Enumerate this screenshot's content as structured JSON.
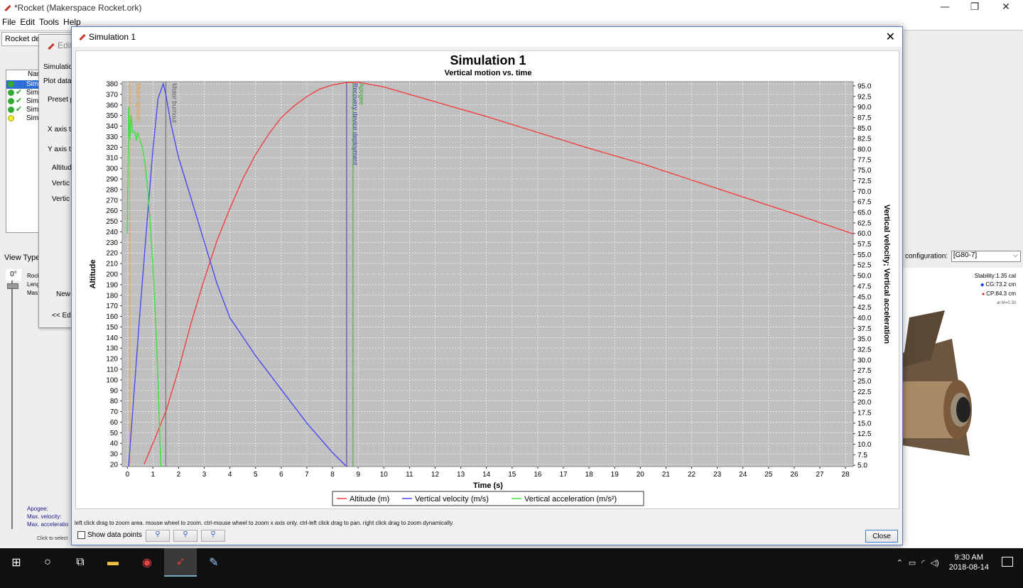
{
  "app": {
    "title": "*Rocket (Makerspace Rocket.ork)",
    "menu": [
      "File",
      "Edit",
      "Tools",
      "Help"
    ],
    "rocket_design_tab": "Rocket desi",
    "simulations": [
      {
        "label": "Simu",
        "status": "selected"
      },
      {
        "label": "Simu",
        "status": "ok"
      },
      {
        "label": "Simu",
        "status": "ok"
      },
      {
        "label": "Simu",
        "status": "ok"
      },
      {
        "label": "Simu",
        "status": "outdated"
      }
    ],
    "sim_list_header": "Nan",
    "view_type": "View Type:",
    "angle": "0°",
    "rocket_info": [
      "Rock",
      "Leng",
      "Mas"
    ],
    "flight_info": [
      "Apogee:",
      "Max. velocity:",
      "Max. acceleratio"
    ],
    "click_select": "Click to select",
    "configuration_label": "configuration:",
    "configuration_value": "[G80-7]",
    "stability": "Stability:1.35 cal",
    "cg": "CG:73.2 cm",
    "cp": "CP:84.3 cm",
    "mach": "at M=0.30"
  },
  "edit_dialog": {
    "title": "Edit",
    "simulation_tab": "Simulatio",
    "plot_tab": "Plot data",
    "preset": "Preset p",
    "x_axis": "X axis t",
    "y_axis": "Y axis t",
    "y_items": [
      "Altitud",
      "Vertic",
      "Vertic"
    ],
    "new_button": "New",
    "edit_button": "<< Ed"
  },
  "plot_dialog": {
    "title": "Simulation 1",
    "hint": "left click drag to zoom area. mouse wheel to zoom. ctrl-mouse wheel to zoom x axis only. ctrl-left click drag to pan.  right click drag to zoom dynamically.",
    "show_data_points": "Show data points",
    "close": "Close",
    "zoom_buttons": [
      "zoom-in",
      "zoom-out",
      "zoom-fit"
    ]
  },
  "chart_data": {
    "type": "line",
    "title": "Simulation 1",
    "subtitle": "Vertical motion vs. time",
    "xlabel": "Time (s)",
    "ylabel": "Altitude",
    "y2label": "Vertical velocity; Vertical acceleration",
    "xlim": [
      -0.2,
      28.3
    ],
    "ylim": [
      18,
      382
    ],
    "y2lim": [
      4.7,
      96.0
    ],
    "x_ticks": [
      0,
      1,
      2,
      3,
      4,
      5,
      6,
      7,
      8,
      9,
      10,
      11,
      12,
      13,
      14,
      15,
      16,
      17,
      18,
      19,
      20,
      21,
      22,
      23,
      24,
      25,
      26,
      27,
      28
    ],
    "y_ticks": [
      20,
      30,
      40,
      50,
      60,
      70,
      80,
      90,
      100,
      110,
      120,
      130,
      140,
      150,
      160,
      170,
      180,
      190,
      200,
      210,
      220,
      230,
      240,
      250,
      260,
      270,
      280,
      290,
      300,
      310,
      320,
      330,
      340,
      350,
      360,
      370,
      380
    ],
    "y2_ticks": [
      "5.0",
      "7.5",
      "10.0",
      "12.5",
      "15.0",
      "17.5",
      "20.0",
      "22.5",
      "25.0",
      "27.5",
      "30.0",
      "32.5",
      "35.0",
      "37.5",
      "40.0",
      "42.5",
      "45.0",
      "47.5",
      "50.0",
      "52.5",
      "55.0",
      "57.5",
      "60.0",
      "62.5",
      "65.0",
      "67.5",
      "70.0",
      "72.5",
      "75.0",
      "77.5",
      "80.0",
      "82.5",
      "85.0",
      "87.5",
      "90.0",
      "92.5",
      "95.0"
    ],
    "grid": true,
    "legend": "bottom-center",
    "events": [
      {
        "label": "Motor ignition",
        "x": 0.1,
        "color": "#e8a040"
      },
      {
        "label": "Motor burnout",
        "x": 1.5,
        "color": "#666666"
      },
      {
        "label": "Recovery device deployment",
        "x": 8.55,
        "color": "#3a3ab8"
      },
      {
        "label": "Apogee",
        "x": 8.8,
        "color": "#3aa83a"
      }
    ],
    "series": [
      {
        "name": "Altitude (m)",
        "axis": "left",
        "color": "#f04040",
        "x": [
          0.65,
          1,
          1.5,
          2,
          2.5,
          3,
          3.5,
          4,
          4.5,
          5,
          5.5,
          6,
          6.5,
          7,
          7.5,
          8,
          8.5,
          9,
          10,
          12,
          14,
          16,
          18,
          20,
          22,
          24,
          26,
          28.3
        ],
        "y": [
          20,
          40,
          70,
          110,
          155,
          195,
          232,
          262,
          290,
          313,
          332,
          348,
          359,
          368,
          375,
          379,
          381,
          381.5,
          377,
          363,
          349,
          334,
          319,
          305,
          289,
          273,
          257,
          238
        ]
      },
      {
        "name": "Vertical velocity (m/s)",
        "axis": "right",
        "color": "#4a4af0",
        "x": [
          0.05,
          0.2,
          0.5,
          0.8,
          1.0,
          1.2,
          1.4,
          1.5,
          1.7,
          2,
          2.5,
          3,
          3.5,
          4,
          5,
          6,
          7,
          8,
          8.55
        ],
        "y": [
          4.7,
          17,
          42,
          65,
          80,
          92,
          95.5,
          93,
          86,
          78,
          68,
          58,
          48,
          40,
          31,
          23,
          15,
          8,
          4.7
        ]
      },
      {
        "name": "Vertical acceleration (m/s²)",
        "axis": "right",
        "color": "#40e040",
        "x": [
          0.0,
          0.05,
          0.1,
          0.15,
          0.2,
          0.3,
          0.35,
          0.4,
          0.5,
          0.6,
          0.7,
          0.8,
          0.9,
          1.0,
          1.1,
          1.2,
          1.3,
          1.35,
          1.4
        ],
        "y": [
          60,
          90,
          82,
          88,
          84,
          84,
          82,
          84,
          82,
          80,
          76,
          70,
          62,
          52,
          40,
          25,
          5,
          4.8,
          4.8
        ]
      }
    ]
  }
}
